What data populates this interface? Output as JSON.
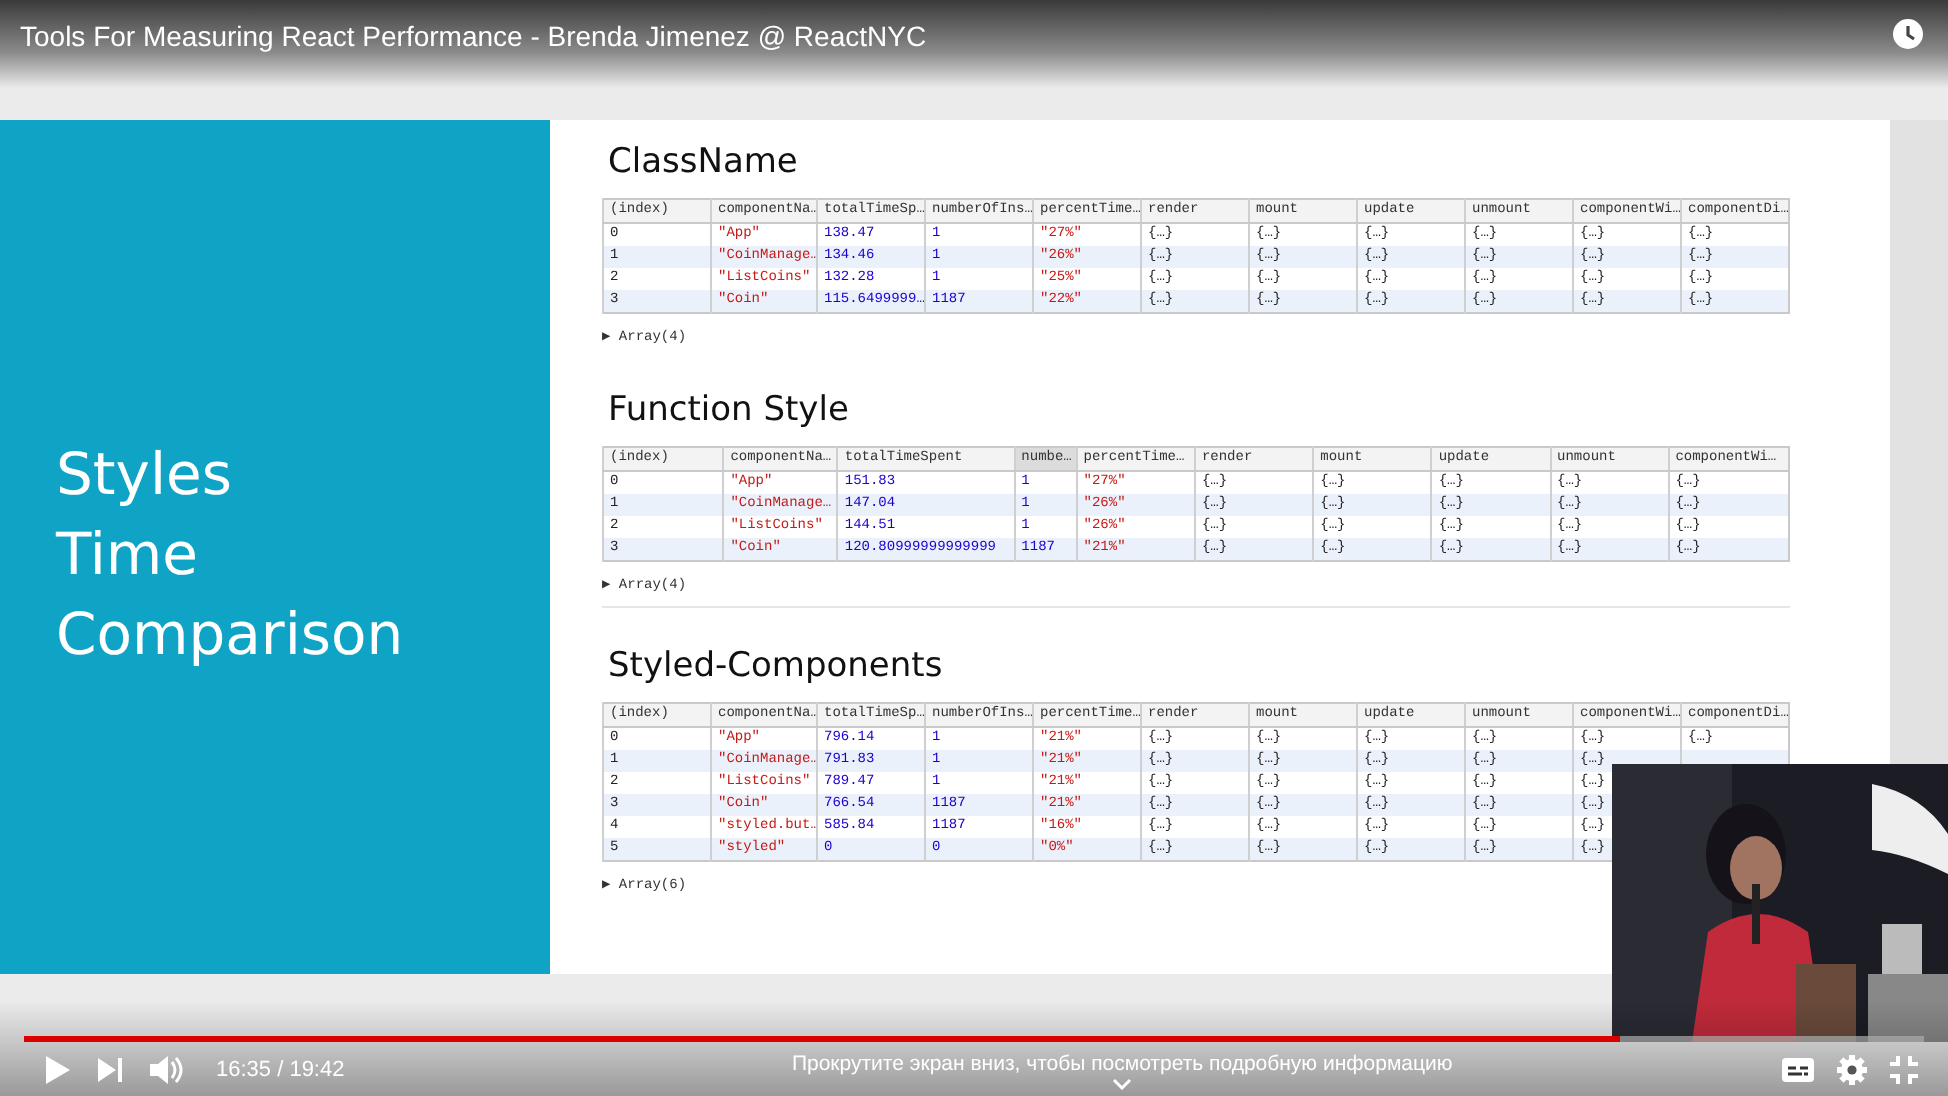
{
  "player": {
    "title": "Tools For Measuring React Performance - Brenda Jimenez @ ReactNYC",
    "time": "16:35 / 19:42",
    "hint": "Прокрутите экран вниз, чтобы посмотреть подробную информацию",
    "progress": {
      "level": 0.84
    }
  },
  "slide": {
    "heading": "Styles\nTime\nComparison",
    "sections": [
      {
        "title": "ClassName",
        "table": {
          "columns": [
            {
              "label": "(index)",
              "kind": "index",
              "sorted": false
            },
            {
              "label": "componentNa…",
              "kind": "string",
              "sorted": false
            },
            {
              "label": "totalTimeSp…",
              "kind": "number",
              "sorted": false
            },
            {
              "label": "numberOfIns…",
              "kind": "number",
              "sorted": false
            },
            {
              "label": "percentTime…",
              "kind": "string",
              "sorted": false
            },
            {
              "label": "render",
              "kind": "object",
              "sorted": false
            },
            {
              "label": "mount",
              "kind": "object",
              "sorted": false
            },
            {
              "label": "update",
              "kind": "object",
              "sorted": false
            },
            {
              "label": "unmount",
              "kind": "object",
              "sorted": false
            },
            {
              "label": "componentWi…",
              "kind": "object",
              "sorted": false
            },
            {
              "label": "componentDi…",
              "kind": "object",
              "sorted": false
            }
          ],
          "rows": [
            [
              "0",
              "\"App\"",
              "138.47",
              "1",
              "\"27%\"",
              "{…}",
              "{…}",
              "{…}",
              "{…}",
              "{…}",
              "{…}"
            ],
            [
              "1",
              "\"CoinManage…",
              "134.46",
              "1",
              "\"26%\"",
              "{…}",
              "{…}",
              "{…}",
              "{…}",
              "{…}",
              "{…}"
            ],
            [
              "2",
              "\"ListCoins\"",
              "132.28",
              "1",
              "\"25%\"",
              "{…}",
              "{…}",
              "{…}",
              "{…}",
              "{…}",
              "{…}"
            ],
            [
              "3",
              "\"Coin\"",
              "115.6499999…",
              "1187",
              "\"22%\"",
              "{…}",
              "{…}",
              "{…}",
              "{…}",
              "{…}",
              "{…}"
            ]
          ],
          "footer": "▶ Array(4)"
        }
      },
      {
        "title": "Function Style",
        "table": {
          "columns": [
            {
              "label": "(index)",
              "kind": "index",
              "sorted": false
            },
            {
              "label": "componentNa…",
              "kind": "string",
              "sorted": false
            },
            {
              "label": "totalTimeSpent",
              "kind": "number",
              "sorted": false
            },
            {
              "label": "numbe…",
              "kind": "number",
              "sorted": true
            },
            {
              "label": "percentTime…",
              "kind": "string",
              "sorted": false
            },
            {
              "label": "render",
              "kind": "object",
              "sorted": false
            },
            {
              "label": "mount",
              "kind": "object",
              "sorted": false
            },
            {
              "label": "update",
              "kind": "object",
              "sorted": false
            },
            {
              "label": "unmount",
              "kind": "object",
              "sorted": false
            },
            {
              "label": "componentWi…",
              "kind": "object",
              "sorted": false
            }
          ],
          "rows": [
            [
              "0",
              "\"App\"",
              "151.83",
              "1",
              "\"27%\"",
              "{…}",
              "{…}",
              "{…}",
              "{…}",
              "{…}"
            ],
            [
              "1",
              "\"CoinManage…",
              "147.04",
              "1",
              "\"26%\"",
              "{…}",
              "{…}",
              "{…}",
              "{…}",
              "{…}"
            ],
            [
              "2",
              "\"ListCoins\"",
              "144.51",
              "1",
              "\"26%\"",
              "{…}",
              "{…}",
              "{…}",
              "{…}",
              "{…}"
            ],
            [
              "3",
              "\"Coin\"",
              "120.80999999999999",
              "1187",
              "\"21%\"",
              "{…}",
              "{…}",
              "{…}",
              "{…}",
              "{…}"
            ]
          ],
          "footer": "▶ Array(4)"
        }
      },
      {
        "title": "Styled-Components",
        "table": {
          "columns": [
            {
              "label": "(index)",
              "kind": "index",
              "sorted": false
            },
            {
              "label": "componentNa…",
              "kind": "string",
              "sorted": false
            },
            {
              "label": "totalTimeSp…",
              "kind": "number",
              "sorted": false
            },
            {
              "label": "numberOfIns…",
              "kind": "number",
              "sorted": false
            },
            {
              "label": "percentTime…",
              "kind": "string",
              "sorted": false
            },
            {
              "label": "render",
              "kind": "object",
              "sorted": false
            },
            {
              "label": "mount",
              "kind": "object",
              "sorted": false
            },
            {
              "label": "update",
              "kind": "object",
              "sorted": false
            },
            {
              "label": "unmount",
              "kind": "object",
              "sorted": false
            },
            {
              "label": "componentWi…",
              "kind": "object",
              "sorted": false
            },
            {
              "label": "componentDi…",
              "kind": "object",
              "sorted": false
            }
          ],
          "rows": [
            [
              "0",
              "\"App\"",
              "796.14",
              "1",
              "\"21%\"",
              "{…}",
              "{…}",
              "{…}",
              "{…}",
              "{…}",
              "{…}"
            ],
            [
              "1",
              "\"CoinManage…",
              "791.83",
              "1",
              "\"21%\"",
              "{…}",
              "{…}",
              "{…}",
              "{…}",
              "{…}"
            ],
            [
              "2",
              "\"ListCoins\"",
              "789.47",
              "1",
              "\"21%\"",
              "{…}",
              "{…}",
              "{…}",
              "{…}",
              "{…}"
            ],
            [
              "3",
              "\"Coin\"",
              "766.54",
              "1187",
              "\"21%\"",
              "{…}",
              "{…}",
              "{…}",
              "{…}",
              "{…}"
            ],
            [
              "4",
              "\"styled.but…",
              "585.84",
              "1187",
              "\"16%\"",
              "{…}",
              "{…}",
              "{…}",
              "{…}",
              "{…}"
            ],
            [
              "5",
              "\"styled\"",
              "0",
              "0",
              "\"0%\"",
              "{…}",
              "{…}",
              "{…}",
              "{…}",
              "{…}"
            ]
          ],
          "footer": "▶ Array(6)"
        }
      }
    ]
  }
}
